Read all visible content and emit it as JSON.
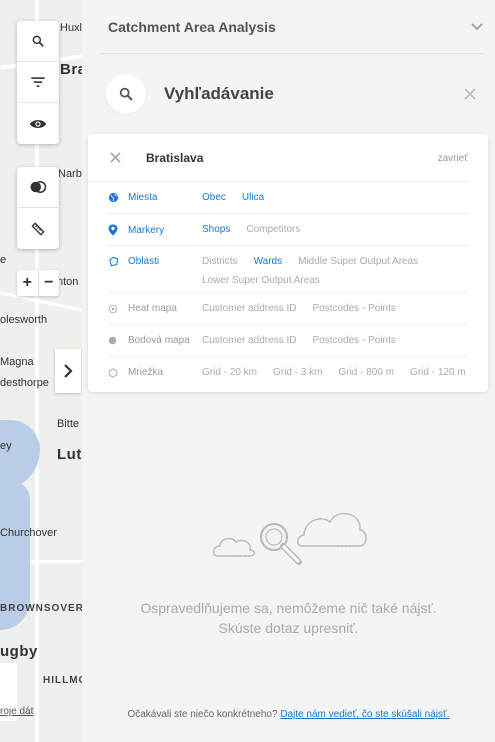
{
  "map": {
    "place_labels": [
      "Huxlo",
      "Bra",
      "Narb",
      "e",
      "nton",
      "olesworth",
      "Magna",
      "desthorpe",
      "Bitte",
      "Lut",
      "ey",
      "Churchover",
      "BROWNSOVER",
      "ugby",
      "HILLMO"
    ],
    "zoom_in": "+",
    "zoom_out": "−",
    "attribution": "roje dát"
  },
  "panel": {
    "header_title": "Catchment Area Analysis",
    "search_title": "Vyhľadávanie",
    "query": "Bratislava",
    "close_text": "zavrieť",
    "rows": [
      {
        "label": "Miesta",
        "icon": "globe-icon",
        "active": true,
        "options": [
          {
            "text": "Obec",
            "active": true
          },
          {
            "text": "Ulica",
            "active": true
          }
        ]
      },
      {
        "label": "Markery",
        "icon": "pin-icon",
        "active": true,
        "options": [
          {
            "text": "Shops",
            "active": true
          },
          {
            "text": "Competitors",
            "active": false
          }
        ]
      },
      {
        "label": "Oblasti",
        "icon": "polygon-icon",
        "active": true,
        "options": [
          {
            "text": "Districts",
            "active": false
          },
          {
            "text": "Wards",
            "active": true
          },
          {
            "text": "Middle Super Output Areas",
            "active": false
          },
          {
            "text": "Lower Super Output Areas",
            "active": false
          }
        ]
      },
      {
        "label": "Heat mapa",
        "icon": "heatmap-icon",
        "active": false,
        "options": [
          {
            "text": "Customer address ID",
            "active": false
          },
          {
            "text": "Postcodes - Points",
            "active": false
          }
        ]
      },
      {
        "label": "Bodová mapa",
        "icon": "dot-icon",
        "active": false,
        "options": [
          {
            "text": "Customer address ID",
            "active": false
          },
          {
            "text": "Postcodes - Points",
            "active": false
          }
        ]
      },
      {
        "label": "Mriežka",
        "icon": "hexagon-icon",
        "active": false,
        "options": [
          {
            "text": "Grid - 20 km",
            "active": false
          },
          {
            "text": "Grid - 3 km",
            "active": false
          },
          {
            "text": "Grid - 800 m",
            "active": false
          },
          {
            "text": "Grid - 120 m",
            "active": false
          }
        ]
      }
    ],
    "empty_line1": "Ospravedlňujeme sa, nemôžeme nič také nájsť.",
    "empty_line2": "Skúste dotaz upresniť.",
    "footer_text": "Očakávali ste niečo konkrétneho? ",
    "footer_link": "Dajte nám vedieť, čo ste skúšali nájsť.",
    "colors": {
      "accent": "#1976d2",
      "muted": "#aaaaaa"
    }
  }
}
